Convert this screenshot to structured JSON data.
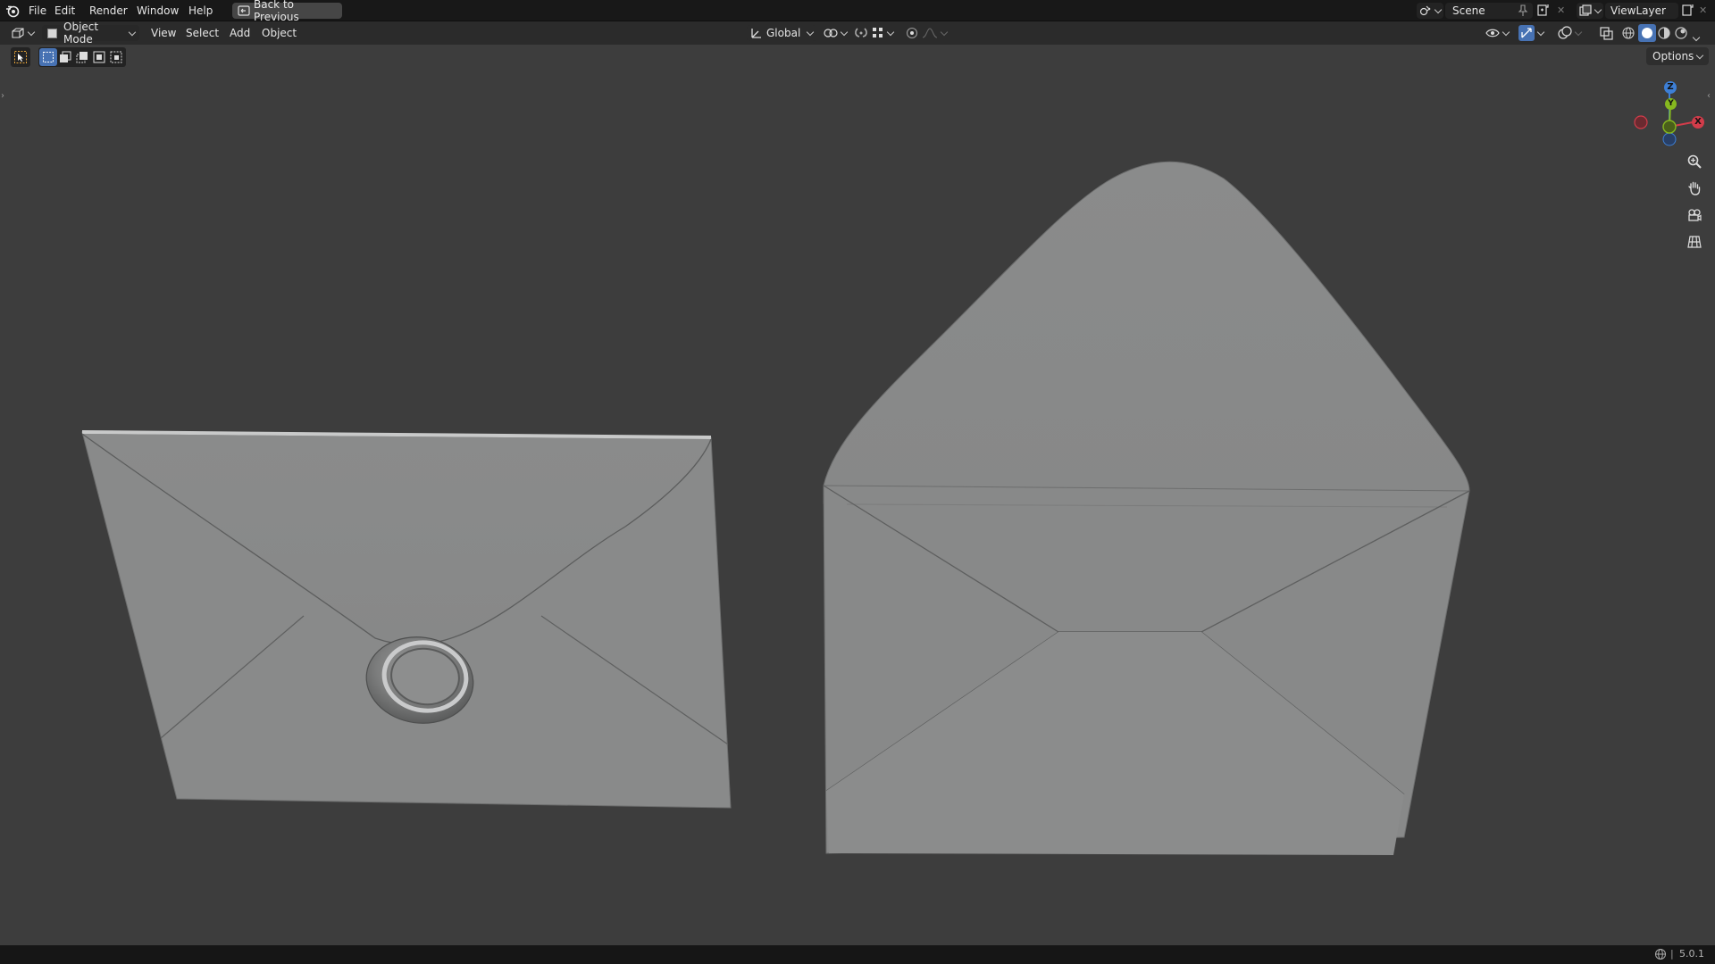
{
  "topbar": {
    "menus": [
      "File",
      "Edit",
      "Render",
      "Window",
      "Help"
    ],
    "back_label": "Back to Previous",
    "scene_name": "Scene",
    "view_layer": "ViewLayer"
  },
  "header": {
    "mode": "Object Mode",
    "menus": [
      "View",
      "Select",
      "Add",
      "Object"
    ],
    "transform_orientation": "Global",
    "options_label": "Options"
  },
  "gizmo": {
    "z": "Z",
    "y": "Y",
    "x": "X"
  },
  "status": {
    "version": "5.0.1"
  },
  "colors": {
    "accent": "#4772b3",
    "axis_x": "#d23c4a",
    "axis_y": "#86b81f",
    "axis_z": "#3d7fd6",
    "viewport_bg": "#3d3d3d",
    "mesh": "#8a8b8b"
  },
  "icons": [
    "blender-logo-icon",
    "back-icon",
    "editor-type-icon",
    "object-mode-icon",
    "orientation-icon",
    "pivot-icon",
    "snap-icon",
    "proportional-icon",
    "zoom-icon",
    "pan-hand-icon",
    "camera-icon",
    "grid-icon",
    "scene-icon",
    "view-layer-icon",
    "pin-icon",
    "new-icon",
    "close-icon",
    "visibility-icon",
    "gizmo-icon",
    "overlay-icon",
    "xray-icon",
    "wireframe-icon",
    "solid-icon",
    "material-icon",
    "rendered-icon",
    "select-tool-icon",
    "globe-icon"
  ]
}
